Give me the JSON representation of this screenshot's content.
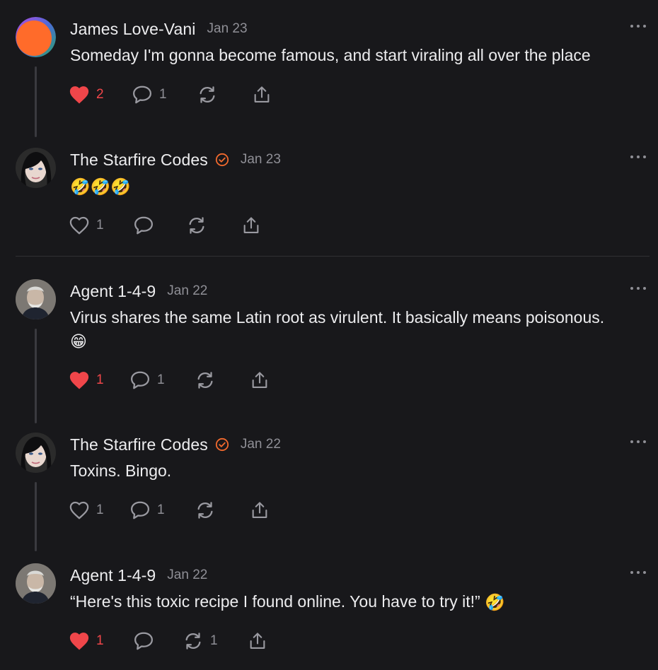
{
  "colors": {
    "background": "#18181b",
    "text": "#ececee",
    "muted": "#8f8f96",
    "like_active": "#f0464a",
    "verified": "#f26a2e"
  },
  "comments": [
    {
      "author": "James Love-Vani",
      "date": "Jan 23",
      "verified": false,
      "text": "Someday I'm gonna become famous, and start viraling all over the place",
      "emoji": "",
      "liked": true,
      "likes": "2",
      "replies": "1",
      "restacks": ""
    },
    {
      "author": "The Starfire Codes",
      "date": "Jan 23",
      "verified": true,
      "text": "",
      "emoji": "🤣🤣🤣",
      "liked": false,
      "likes": "1",
      "replies": "",
      "restacks": ""
    },
    {
      "author": "Agent 1-4-9",
      "date": "Jan 22",
      "verified": false,
      "text": "Virus shares the same Latin root as virulent. It basically means poisonous.",
      "emoji": "😁",
      "liked": true,
      "likes": "1",
      "replies": "1",
      "restacks": ""
    },
    {
      "author": "The Starfire Codes",
      "date": "Jan 22",
      "verified": true,
      "text": "Toxins. Bingo.",
      "emoji": "",
      "liked": false,
      "likes": "1",
      "replies": "1",
      "restacks": ""
    },
    {
      "author": "Agent 1-4-9",
      "date": "Jan 22",
      "verified": false,
      "text": "“Here's this toxic recipe I found online. You have to try it!”",
      "emoji": "🤣",
      "liked": true,
      "likes": "1",
      "replies": "",
      "restacks": "1"
    }
  ],
  "icons": {
    "like": "heart-icon",
    "reply": "comment-bubble-icon",
    "restack": "restack-arrows-icon",
    "share": "share-upload-icon",
    "more": "more-dots-icon",
    "verified": "verified-check-icon"
  }
}
